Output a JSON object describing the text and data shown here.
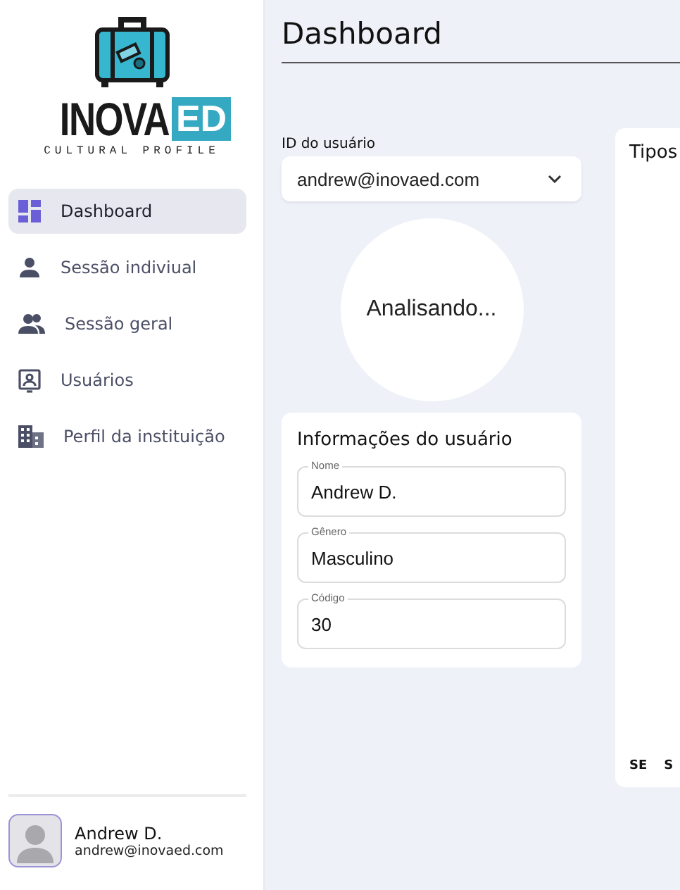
{
  "logo": {
    "brand": "INOVA",
    "badge": "ED",
    "tagline": "CULTURAL PROFILE"
  },
  "sidebar": {
    "items": [
      {
        "label": "Dashboard",
        "selected": true
      },
      {
        "label": "Sessão indiviual",
        "selected": false
      },
      {
        "label": "Sessão geral",
        "selected": false
      },
      {
        "label": "Usuários",
        "selected": false
      },
      {
        "label": "Perfil da instituição",
        "selected": false
      }
    ],
    "user": {
      "name": "Andrew D.",
      "email": "andrew@inovaed.com"
    }
  },
  "page_title": "Dashboard",
  "user_select": {
    "label": "ID do usuário",
    "value": "andrew@inovaed.com"
  },
  "status_circle": "Analisando...",
  "user_info": {
    "title": "Informações do usuário",
    "fields": [
      {
        "label": "Nome",
        "value": "Andrew D."
      },
      {
        "label": "Gênero",
        "value": "Masculino"
      },
      {
        "label": "Código",
        "value": "30"
      }
    ]
  },
  "types_card": {
    "title": "Tipos",
    "labels": [
      "SE",
      "S"
    ]
  }
}
